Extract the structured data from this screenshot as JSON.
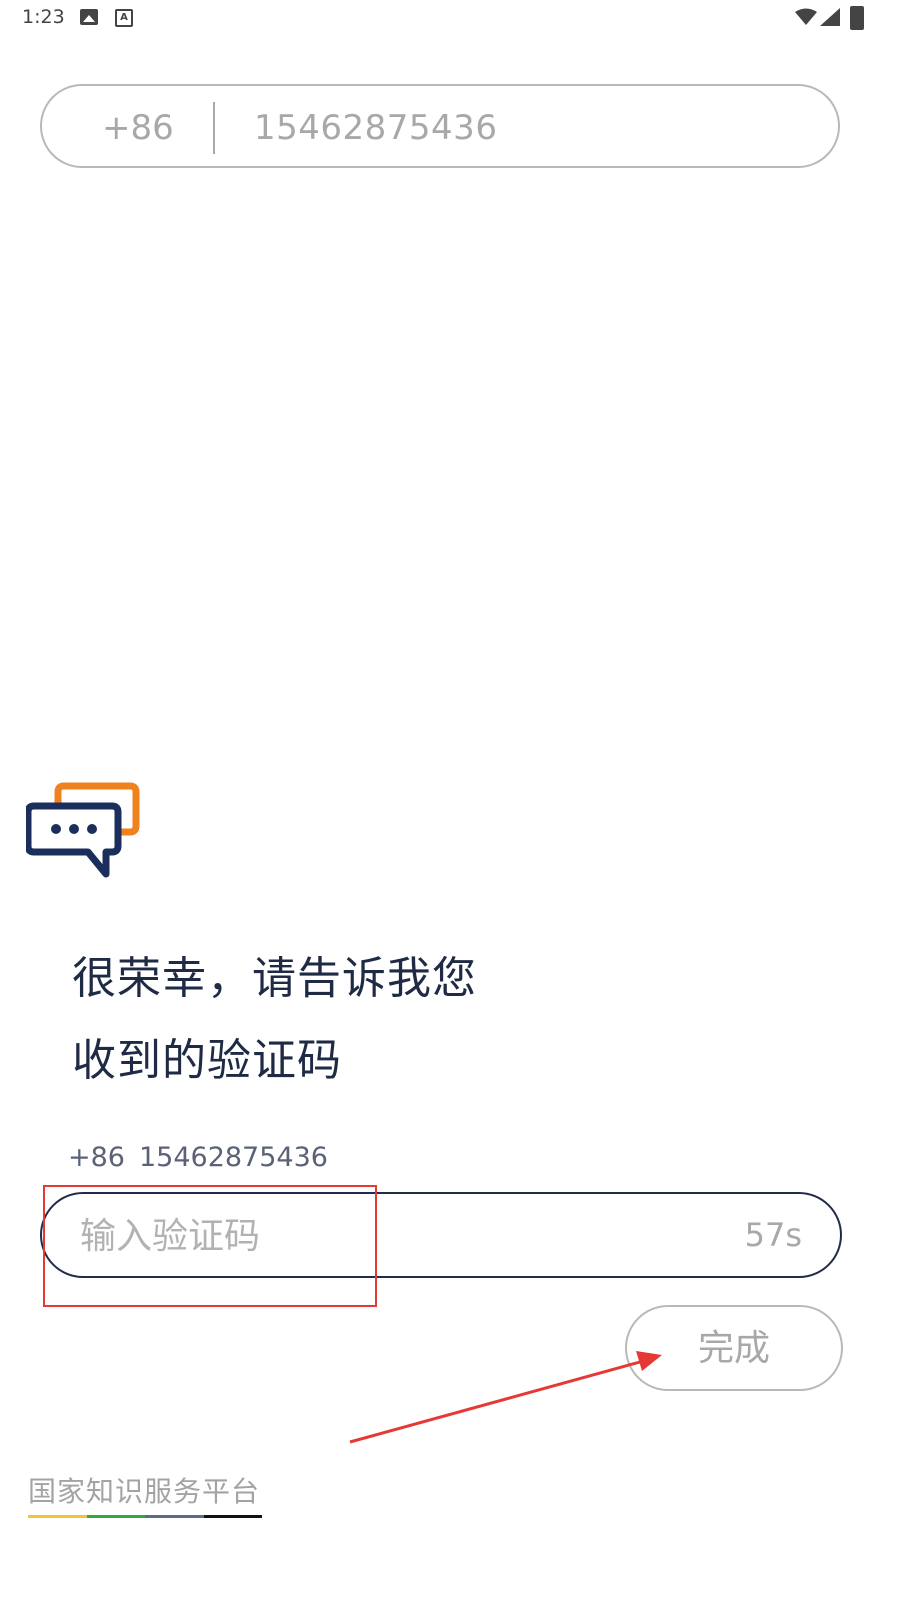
{
  "status_bar": {
    "time": "1:23",
    "icons": [
      "image-icon",
      "a-icon",
      "wifi-icon",
      "signal-icon",
      "battery-icon"
    ]
  },
  "phone_bar": {
    "country_code": "+86",
    "number": "15462875436"
  },
  "prompt": {
    "line1": "很荣幸，请告诉我您",
    "line2": "收到的验证码"
  },
  "phone_hint": {
    "country_code": "+86",
    "number": "15462875436"
  },
  "code_input": {
    "value": "",
    "placeholder": "输入验证码",
    "countdown": "57s"
  },
  "done_button": {
    "label": "完成"
  },
  "footer": {
    "label": "国家知识服务平台",
    "bar_colors": [
      "#f4c430",
      "#2eaa3f",
      "#5b6b8c",
      "#111111"
    ]
  },
  "colors": {
    "primary_text": "#1f2a44",
    "muted": "#a8a8a8",
    "logo_blue": "#1c2f5c",
    "logo_orange": "#f0821e",
    "annotation": "#e53935"
  }
}
